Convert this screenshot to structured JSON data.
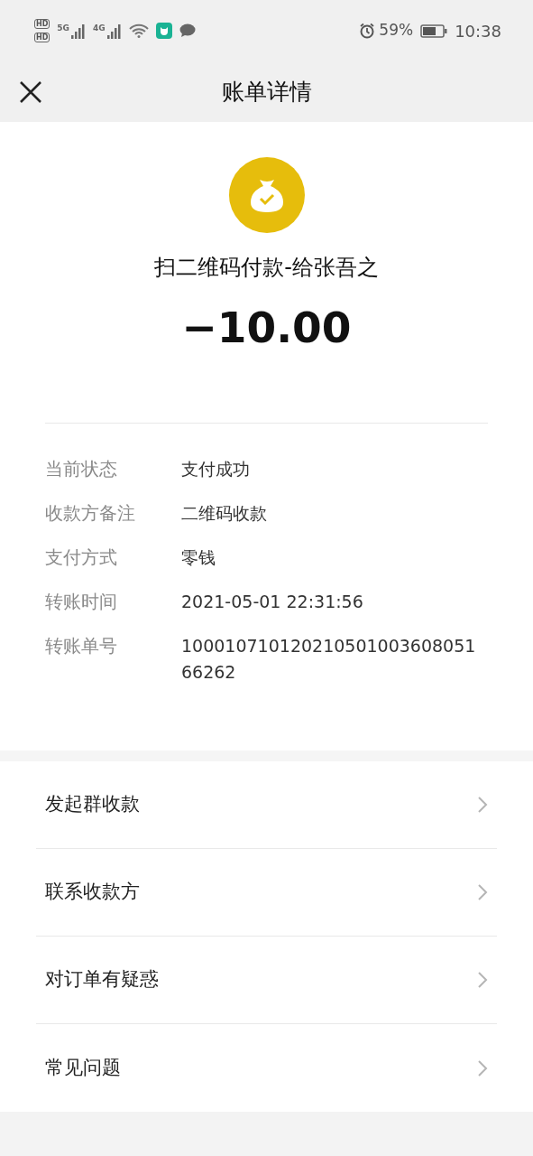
{
  "status_bar": {
    "sim_badges": [
      "HD",
      "HD"
    ],
    "network_types": [
      "5G",
      "4G"
    ],
    "battery_percent": "59%",
    "time": "10:38"
  },
  "header": {
    "title": "账单详情"
  },
  "summary": {
    "description": "扫二维码付款-给张吾之",
    "amount": "−10.00"
  },
  "details": [
    {
      "label": "当前状态",
      "value": "支付成功"
    },
    {
      "label": "收款方备注",
      "value": "二维码收款"
    },
    {
      "label": "支付方式",
      "value": "零钱"
    },
    {
      "label": "转账时间",
      "value": "2021-05-01 22:31:56"
    },
    {
      "label": "转账单号",
      "value": "10001071012021050100360805166262"
    }
  ],
  "actions": [
    {
      "label": "发起群收款"
    },
    {
      "label": "联系收款方"
    },
    {
      "label": "对订单有疑惑"
    },
    {
      "label": "常见问题"
    }
  ]
}
